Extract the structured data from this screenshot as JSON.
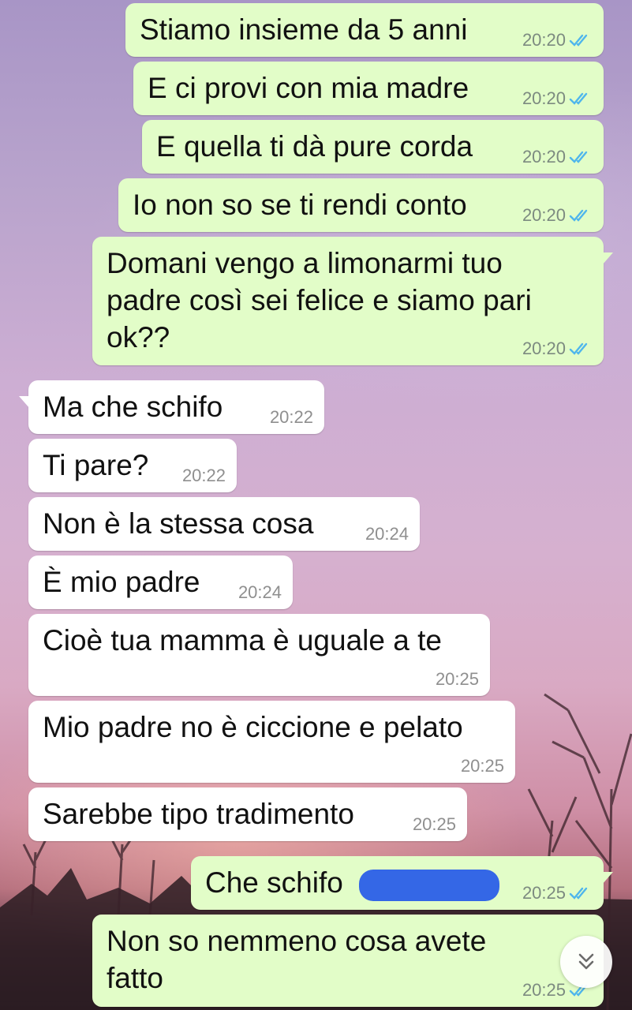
{
  "colors": {
    "outgoing_bubble": "#e2fdc8",
    "incoming_bubble": "#ffffff",
    "read_ticks": "#4fb6ec",
    "redaction": "#3467e6"
  },
  "messages": [
    {
      "text": "Stiamo insieme da 5 anni",
      "time": "20:20",
      "direction": "outgoing",
      "status": "read-ticks-icon"
    },
    {
      "text": "E ci provi con mia madre",
      "time": "20:20",
      "direction": "outgoing",
      "status": "read-ticks-icon"
    },
    {
      "text": "E quella ti dà pure corda",
      "time": "20:20",
      "direction": "outgoing",
      "status": "read-ticks-icon"
    },
    {
      "text": "Io non so se ti rendi conto",
      "time": "20:20",
      "direction": "outgoing",
      "status": "read-ticks-icon"
    },
    {
      "text": "Domani vengo a limonarmi tuo padre così sei felice e siamo pari ok??",
      "time": "20:20",
      "direction": "outgoing",
      "status": "read-ticks-icon"
    },
    {
      "text": "Ma che schifo",
      "time": "20:22",
      "direction": "incoming"
    },
    {
      "text": "Ti pare?",
      "time": "20:22",
      "direction": "incoming"
    },
    {
      "text": "Non è la stessa cosa",
      "time": "20:24",
      "direction": "incoming"
    },
    {
      "text": "È mio padre",
      "time": "20:24",
      "direction": "incoming"
    },
    {
      "text": "Cioè tua mamma è uguale a te",
      "time": "20:25",
      "direction": "incoming"
    },
    {
      "text": "Mio padre no è ciccione e pelato",
      "time": "20:25",
      "direction": "incoming"
    },
    {
      "text": "Sarebbe tipo tradimento",
      "time": "20:25",
      "direction": "incoming"
    },
    {
      "text": "Che schifo",
      "time": "20:25",
      "direction": "outgoing",
      "status": "read-ticks-icon",
      "redacted": true
    },
    {
      "text": "Non so nemmeno cosa avete fatto",
      "time": "20:25",
      "direction": "outgoing",
      "status": "read-ticks-icon"
    }
  ],
  "scroll_button": {
    "icon": "double-chevron-down-icon"
  }
}
